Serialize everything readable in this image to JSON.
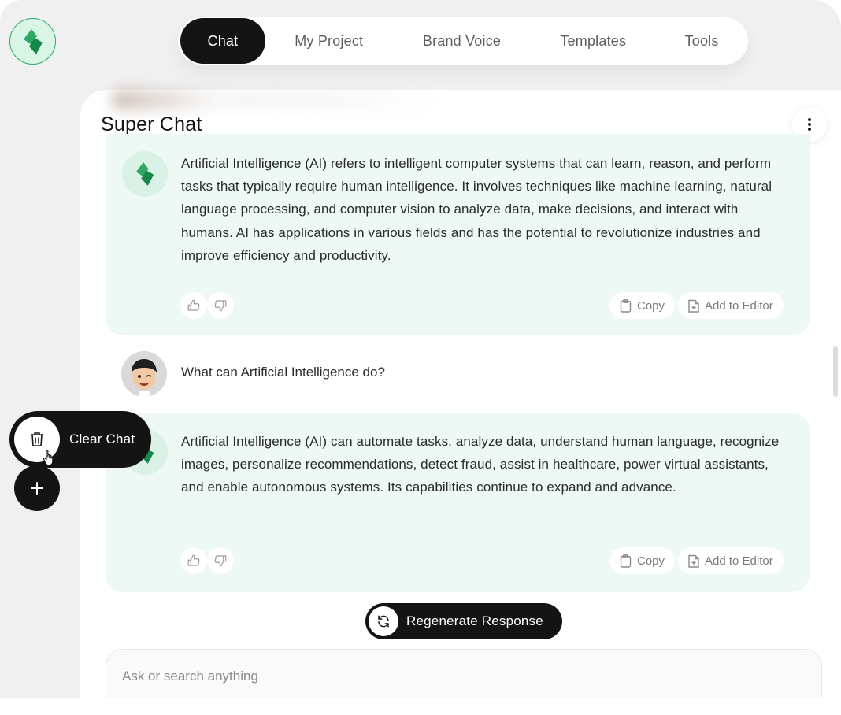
{
  "app": {
    "logo_icon": "bolt-logo-icon",
    "brand_color": "#2ea864"
  },
  "nav": {
    "tabs": [
      {
        "label": "Chat",
        "active": true
      },
      {
        "label": "My Project",
        "active": false
      },
      {
        "label": "Brand Voice",
        "active": false
      },
      {
        "label": "Templates",
        "active": false
      },
      {
        "label": "Tools",
        "active": false
      }
    ]
  },
  "chat": {
    "title": "Super Chat",
    "messages": [
      {
        "role": "assistant",
        "text": "Artificial Intelligence (AI) refers to intelligent computer systems that can learn, reason, and perform tasks that typically require human intelligence. It involves techniques like machine learning, natural language processing, and computer vision to analyze data, make decisions, and interact with humans. AI has applications in various fields and has the potential to revolutionize industries and improve efficiency and productivity."
      },
      {
        "role": "user",
        "text": "What can Artificial Intelligence do?"
      },
      {
        "role": "assistant",
        "text": "Artificial Intelligence (AI) can automate tasks, analyze data, understand human language, recognize images, personalize recommendations, detect fraud, assist in healthcare, power virtual assistants, and enable autonomous systems. Its capabilities continue to expand and advance."
      }
    ],
    "actions": {
      "copy_label": "Copy",
      "add_to_editor_label": "Add to Editor"
    },
    "regenerate_label": "Regenerate Response",
    "input_placeholder": "Ask or search anything",
    "input_value": ""
  },
  "floating": {
    "clear_chat_label": "Clear Chat"
  },
  "colors": {
    "accent_dark": "#141414",
    "ai_bubble": "#eef8f4",
    "app_background": "#f0f0f0"
  }
}
